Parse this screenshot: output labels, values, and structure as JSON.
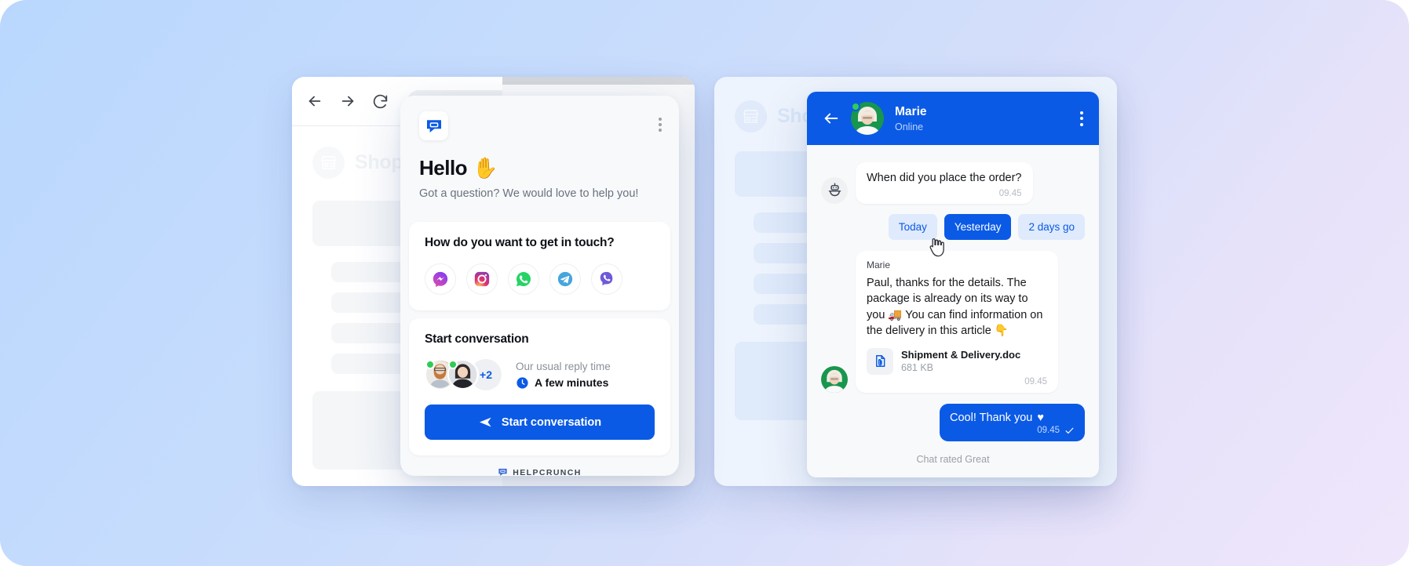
{
  "background": {
    "from": "#b9d7fd",
    "to": "#efe6fb"
  },
  "accent": "#0a5ae6",
  "left_window": {
    "browser_back_icon": "arrow-left-icon",
    "browser_forward_icon": "arrow-right-icon",
    "browser_reload_icon": "reload-icon",
    "site_name": "Shop",
    "shop_icon": "storefront-icon"
  },
  "right_window": {
    "site_name": "Shop",
    "shop_icon": "storefront-icon"
  },
  "widget": {
    "logo_icon": "helpcrunch-chat-icon",
    "menu_icon": "kebab-menu-icon",
    "greeting": "Hello",
    "greeting_emoji": "✋",
    "subtitle": "Got a question? We would love to help you!",
    "channels_title": "How do you want to get in touch?",
    "channels": [
      {
        "name": "messenger",
        "icon": "messenger-icon",
        "color": "#a334fa"
      },
      {
        "name": "instagram",
        "icon": "instagram-icon",
        "color": "#e1306c"
      },
      {
        "name": "whatsapp",
        "icon": "whatsapp-icon",
        "color": "#25d366"
      },
      {
        "name": "telegram",
        "icon": "telegram-icon",
        "color": "#2fa5e0"
      },
      {
        "name": "viber",
        "icon": "viber-icon",
        "color": "#6e5ad8"
      }
    ],
    "start_title": "Start conversation",
    "extra_agents": "+2",
    "reply_time_label": "Our usual reply time",
    "reply_time_value": "A few minutes",
    "reply_time_icon": "clock-icon",
    "start_button_label": "Start conversation",
    "start_button_icon": "send-icon",
    "footer_brand": "HELPCRUNCH",
    "footer_icon": "helpcrunch-logo-icon"
  },
  "chat": {
    "back_icon": "arrow-left-icon",
    "menu_icon": "kebab-menu-icon",
    "agent_name": "Marie",
    "agent_status": "Online",
    "bot_icon": "robot-icon",
    "bot_message": "When did you place the order?",
    "bot_message_time": "09.45",
    "quick_replies": [
      {
        "label": "Today",
        "selected": false
      },
      {
        "label": "Yesterday",
        "selected": true
      },
      {
        "label": "2 days go",
        "selected": false
      }
    ],
    "cursor_icon": "pointer-hand-icon",
    "agent_message_sender": "Marie",
    "agent_message": "Paul, thanks for the details. The package is already on its way to you 🚚 You can find information on the delivery in this article 👇",
    "file_icon": "document-attachment-icon",
    "file_name": "Shipment & Delivery.doc",
    "file_size": "681 KB",
    "agent_message_time": "09.45",
    "user_message": "Cool! Thank you",
    "user_message_emoji": "♥",
    "user_message_time": "09.45",
    "user_message_status_icon": "check-icon",
    "rating_text": "Chat rated Great"
  }
}
